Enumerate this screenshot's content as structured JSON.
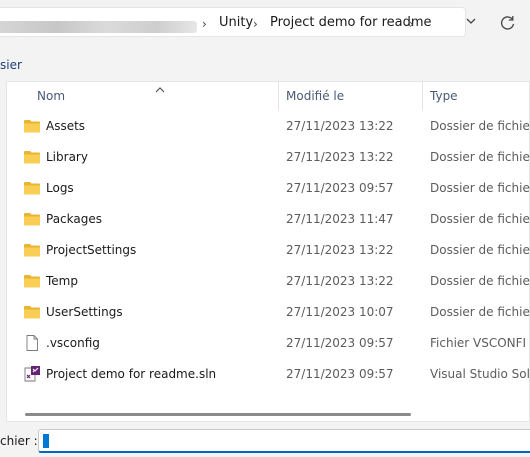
{
  "breadcrumb": {
    "items": [
      {
        "label": "Unity"
      },
      {
        "label": "Project demo for readme"
      }
    ]
  },
  "toolbar": {
    "new_folder_label": "sier"
  },
  "list": {
    "columns": {
      "name": "Nom",
      "modified": "Modifié le",
      "type": "Type"
    },
    "rows": [
      {
        "name": "Assets",
        "date": "27/11/2023 13:22",
        "type": "Dossier de fichie",
        "icon": "folder-icon"
      },
      {
        "name": "Library",
        "date": "27/11/2023 13:22",
        "type": "Dossier de fichie",
        "icon": "folder-icon"
      },
      {
        "name": "Logs",
        "date": "27/11/2023 09:57",
        "type": "Dossier de fichie",
        "icon": "folder-icon"
      },
      {
        "name": "Packages",
        "date": "27/11/2023 11:47",
        "type": "Dossier de fichie",
        "icon": "folder-icon"
      },
      {
        "name": "ProjectSettings",
        "date": "27/11/2023 13:22",
        "type": "Dossier de fichie",
        "icon": "folder-icon"
      },
      {
        "name": "Temp",
        "date": "27/11/2023 13:22",
        "type": "Dossier de fichie",
        "icon": "folder-icon"
      },
      {
        "name": "UserSettings",
        "date": "27/11/2023 10:07",
        "type": "Dossier de fichie",
        "icon": "folder-icon"
      },
      {
        "name": ".vsconfig",
        "date": "27/11/2023 09:57",
        "type": "Fichier VSCONFI",
        "icon": "file-icon"
      },
      {
        "name": "Project demo for readme.sln",
        "date": "27/11/2023 09:57",
        "type": "Visual Studio Sol",
        "icon": "visual-studio-solution-icon"
      }
    ]
  },
  "filename": {
    "label": "chier :",
    "value": ""
  },
  "colors": {
    "accent": "#0067c0",
    "folder": "#f4c542",
    "header_text": "#4a5a78"
  }
}
